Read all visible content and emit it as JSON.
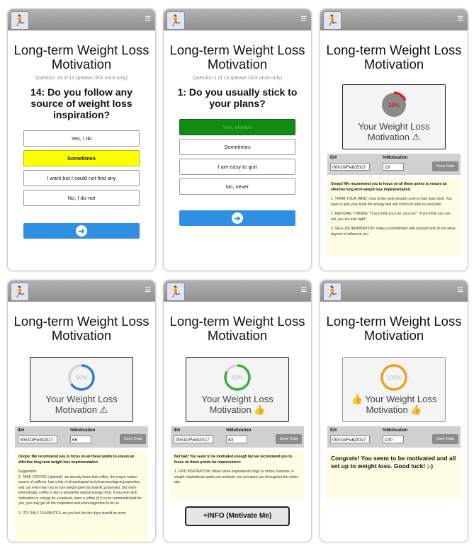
{
  "app": {
    "title": "Long-term Weight Loss Motivation",
    "title_line1": "Long-term Weight Loss",
    "title_line2": "Motivation"
  },
  "icons": {
    "logo": "runner-logo-icon",
    "menu": "hamburger-menu-icon",
    "next": "arrow-right-circle-icon",
    "warning": "warning-triangle-icon",
    "thumb": "thumbs-up-icon"
  },
  "colors": {
    "red": "#e11d1d",
    "blue": "#2f8fe2",
    "green": "#3cb043",
    "orange": "#f0a020",
    "yellow": "#ffff00",
    "selected_green": "#138a13"
  },
  "screen1": {
    "qnum": "Question 14 of 14 (please click once only)",
    "question": "14: Do you follow any source of weight loss inspiration?",
    "answers": [
      "Yes, I do",
      "Sometimes",
      "I want but I could not find any",
      "No, I do not"
    ],
    "selected": "Sometimes"
  },
  "screen2": {
    "qnum": "Question 1 of 14 (please click once only)",
    "question": "1: Do you usually stick to your plans?",
    "answers": [
      "Yes, always",
      "Sometimes",
      "I am easy to quit",
      "No, never"
    ],
    "selected": "Yes, always"
  },
  "results": {
    "label": "Your Weight Loss Motivation",
    "label_line1": "Your Weight Loss",
    "label_line2": "Motivation",
    "id_label": "ID#",
    "pct_label": "%Motivation",
    "save": "Save Data",
    "id_value": "00#10/Feb/2017"
  },
  "screen3": {
    "percent": 19,
    "percent_text": "19%",
    "pct_value": "19",
    "lead": "Ooops! We recommend you to focus on all these points to ensure an effective long-term weight loss implementation:",
    "points": [
      "1. TRAIN YOUR MIND: most of the work should come to train your mind. You have to give your brain the energy and self control to stick to your plan",
      "2. RATIONAL THIKING: \"If you think you can, you can\"; \"if you think you can not, you are also right\"",
      "3. SELF-DETERMINATION: make a commitment with yourself and do not allow anyone to influence you"
    ]
  },
  "screen4": {
    "percent": 66,
    "percent_text": "66%",
    "pct_value": "66",
    "lead": "Ooops! We recommend you to focus on all these points to ensure an effective long-term weight loss implementation:",
    "points": [
      "Suggestion:",
      "1. TAKE COFFEE (optional): we already know that coffee, the mayor nature source of caffeine, has a lots of physiological and pharmacological properties, and can even help you to lose weight given its lipolytic properties. But more interestingly, coffee is also a wonderful natural energy drink. If you ever lack motivation or energy for a workout, have a coffee (if it is not contraindicated for you, you may get all the inspiration and encouragement to do so",
      "2. IT'S ONLY 10 MINUTES: do you feel like the days should be more"
    ]
  },
  "screen5": {
    "percent": 83,
    "percent_text": "83%",
    "pct_value": "83",
    "lead": "Not bad! You seem to be motivated enough but we recommend you to focus on these points for improvement:",
    "points": [
      "1. FIND INSPIRATION: follow some inspirational blogs or online channels. A simple inspirational quote can motivate you or inspire you throughout the whole day"
    ],
    "info_button": "+INFO (Motivate Me)"
  },
  "screen6": {
    "percent": 100,
    "percent_text": "100%",
    "pct_value": "100",
    "lead": "Congrats! You seem to be motivated and all set up to weight loss. Good luck! ;-)"
  }
}
